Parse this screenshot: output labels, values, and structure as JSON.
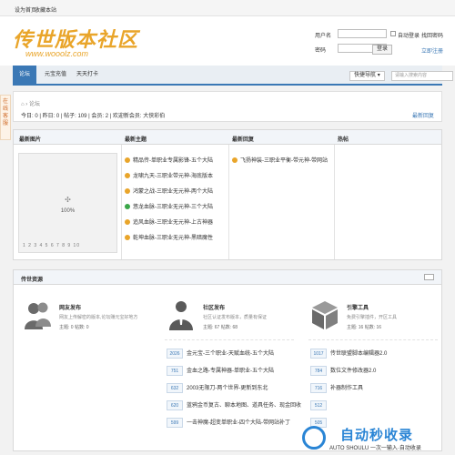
{
  "topbar": {
    "home": "设为首页",
    "bookmark": "收藏本站"
  },
  "header": {
    "logo_text": "传世版本社区",
    "logo_url": "www.wooolz.com",
    "username_label": "用户名",
    "auto_login": "自动登录",
    "forgot": "找回密码",
    "password_label": "密码",
    "login_btn": "登录",
    "register": "立即注册"
  },
  "nav": {
    "tabs": [
      "论坛",
      "元宝充值",
      "天天打卡"
    ],
    "quick_nav": "快捷导航",
    "search_placeholder": "请输入搜索内容"
  },
  "side_tag": "在线客服",
  "breadcrumb": {
    "path": "⌂ › 论坛",
    "stats": "今日: 0 | 昨日: 0 | 帖子: 109 | 会员: 2 | 欢迎新会员: 大侠彩伯",
    "latest": "最新回复"
  },
  "portal": {
    "headers": [
      "最新图片",
      "最新主题",
      "最新回复",
      "热帖"
    ],
    "slide_caption": "100%",
    "slide_nums": "1 2 3 4 5 6 7 8 9 10",
    "topics": [
      {
        "text": "精品传-单职业专属影锋-五个大陆",
        "color": "#e9a52a"
      },
      {
        "text": "龙啸九天-三职业带元神-海底版本",
        "color": "#e9a52a"
      },
      {
        "text": "鸿蒙之战-三职业无元神-两个大陆",
        "color": "#e9a52a"
      },
      {
        "text": "悠龙血脉-三职业无元神-三个大陆",
        "color": "#3aa648"
      },
      {
        "text": "追风血脉-三职业无元神-上古神器",
        "color": "#e9a52a"
      },
      {
        "text": "乾坤血脉-三职业无元神-黑暗魔性",
        "color": "#e9a52a"
      }
    ],
    "replies": [
      {
        "text": "飞扬神装-三职业平衡-带元神-带网站",
        "color": "#e9a52a"
      }
    ]
  },
  "resources": {
    "title": "传世资源",
    "cards": [
      {
        "title": "网友发布",
        "desc": "网友上传解密的版本,论坛赚元宝好地方",
        "stats": "主题: 0    帖数: 0",
        "items": []
      },
      {
        "title": "社区发布",
        "desc": "社区认证发布版本，质量有保证",
        "stats": "主题: 67    帖数: 68",
        "items": [
          {
            "n": "2026",
            "t": "金元宝-三个职业-天赋血统-五个大陆"
          },
          {
            "n": "751",
            "t": "金血之路-专属神器-单职业-五个大陆"
          },
          {
            "n": "632",
            "t": "2003无限刀-两个世界-更新到东北"
          },
          {
            "n": "620",
            "t": "蓝鸦金币复古、聊本地图、道具任务、现金回收"
          },
          {
            "n": "599",
            "t": "一击神魔-超变单职业-四个大陆-带网站补丁"
          }
        ]
      },
      {
        "title": "引擎工具",
        "desc": "免费引擎插件，开区工具",
        "stats": "主题: 16    帖数: 16",
        "items": [
          {
            "n": "1017",
            "t": "传世联盟脚本编辑器2.0"
          },
          {
            "n": "784",
            "t": "数位文件修改器2.0"
          },
          {
            "n": "716",
            "t": "补器制作工具"
          },
          {
            "n": "512",
            "t": ""
          },
          {
            "n": "505",
            "t": ""
          }
        ]
      }
    ]
  },
  "watermark": {
    "big": "自动秒收录",
    "small": "AUTO SHOULU 一次一输入·自动收录"
  },
  "colors": {
    "accent": "#3b78b5",
    "logo": "#e9a52a"
  }
}
